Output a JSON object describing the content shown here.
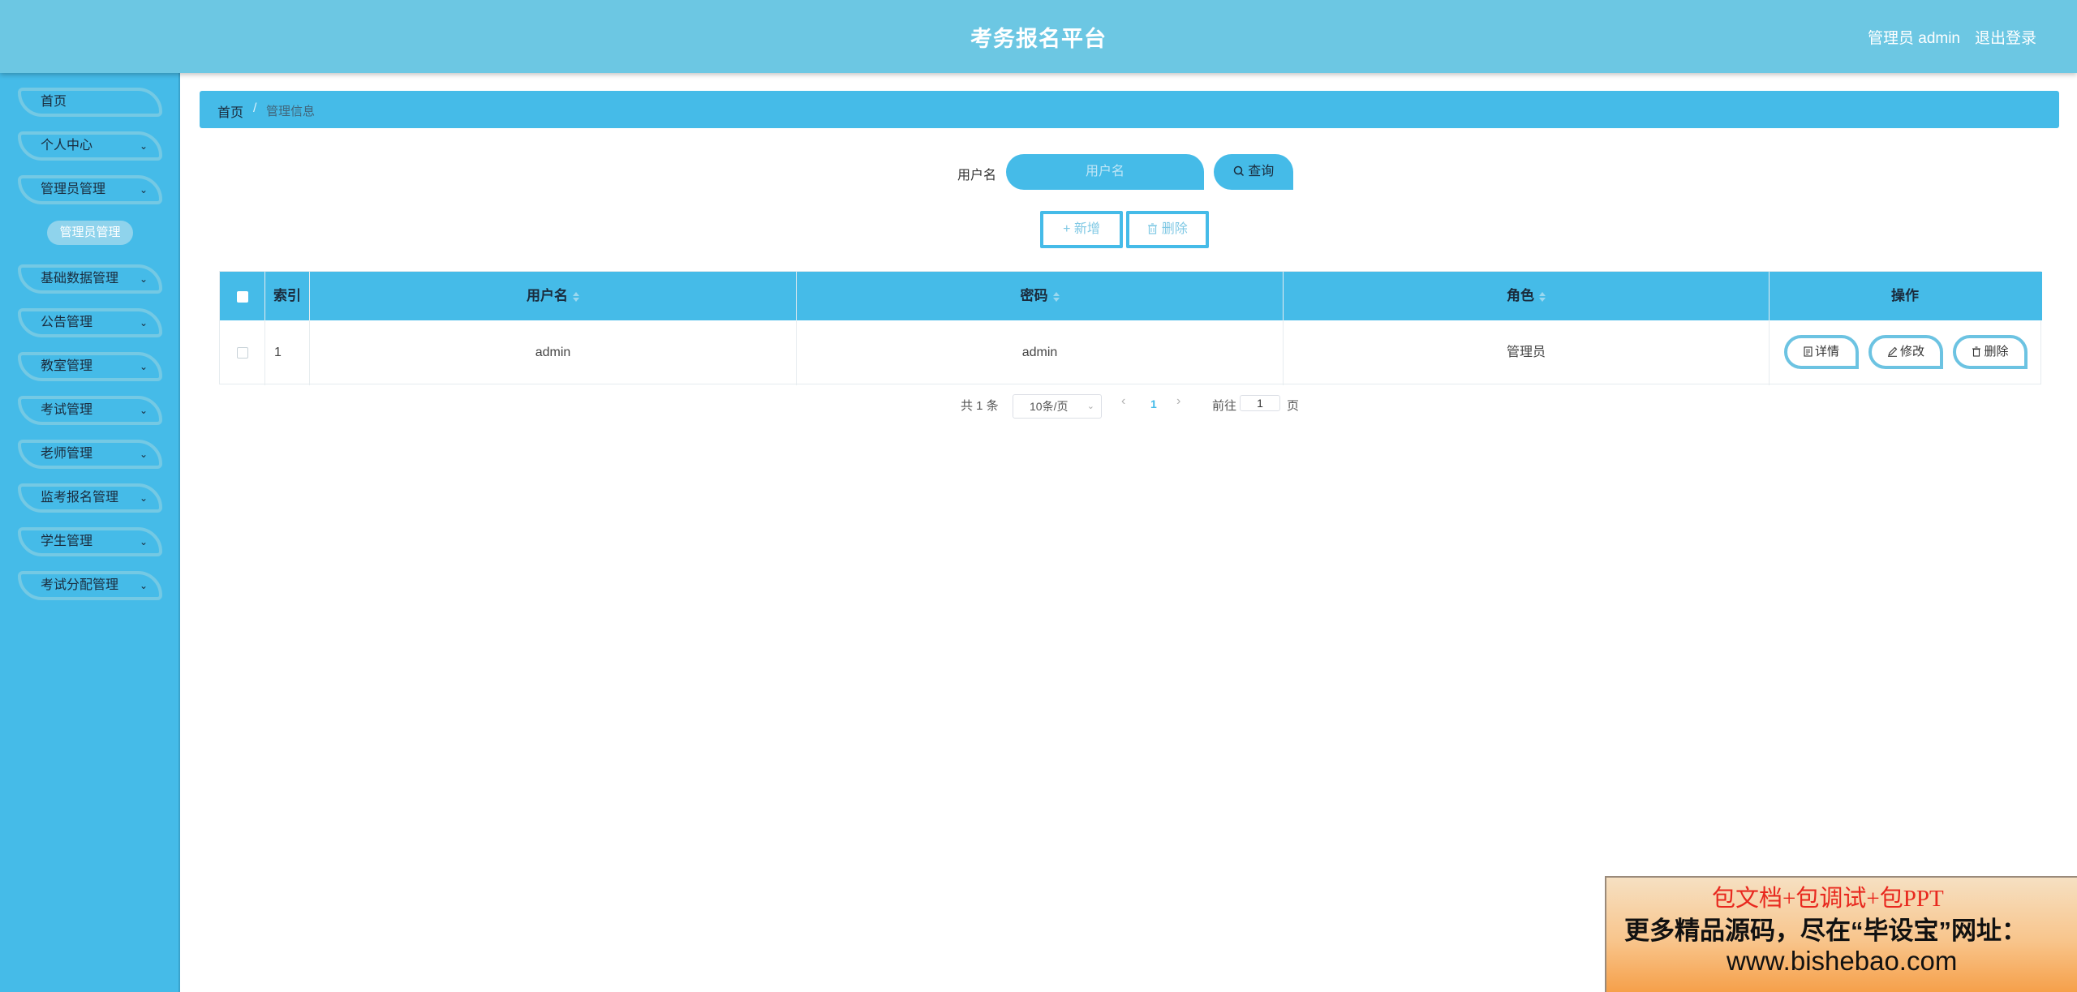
{
  "header": {
    "title": "考务报名平台",
    "user": "管理员 admin",
    "logout": "退出登录"
  },
  "sidebar": {
    "items": [
      {
        "label": "首页",
        "has_chevron": false
      },
      {
        "label": "个人中心",
        "has_chevron": true
      },
      {
        "label": "管理员管理",
        "has_chevron": true
      },
      {
        "label": "基础数据管理",
        "has_chevron": true
      },
      {
        "label": "公告管理",
        "has_chevron": true
      },
      {
        "label": "教室管理",
        "has_chevron": true
      },
      {
        "label": "考试管理",
        "has_chevron": true
      },
      {
        "label": "老师管理",
        "has_chevron": true
      },
      {
        "label": "监考报名管理",
        "has_chevron": true
      },
      {
        "label": "学生管理",
        "has_chevron": true
      },
      {
        "label": "考试分配管理",
        "has_chevron": true
      }
    ],
    "sub_item": "管理员管理"
  },
  "breadcrumb": {
    "home": "首页",
    "separator": "/",
    "current": "管理信息"
  },
  "search": {
    "label": "用户名",
    "placeholder": "用户名",
    "button": "查询"
  },
  "actions": {
    "add": "新增",
    "delete": "删除"
  },
  "table": {
    "columns": [
      "索引",
      "用户名",
      "密码",
      "角色",
      "操作"
    ],
    "rows": [
      {
        "index": "1",
        "username": "admin",
        "password": "admin",
        "role": "管理员"
      }
    ],
    "row_actions": {
      "detail": "详情",
      "edit": "修改",
      "delete": "删除"
    }
  },
  "pagination": {
    "total": "共 1 条",
    "page_size": "10条/页",
    "current_page": "1",
    "goto_label": "前往",
    "goto_value": "1",
    "page_suffix": "页"
  },
  "promo": {
    "line1": "包文档+包调试+包PPT",
    "line2": "更多精品源码，尽在“毕设宝”网址：",
    "line3": "www.bishebao.com"
  },
  "colors": {
    "header_bg": "#6cc7e3",
    "sidebar_bg": "#45bbe8",
    "accent": "#45bbe8",
    "promo_red": "#e8281e"
  }
}
